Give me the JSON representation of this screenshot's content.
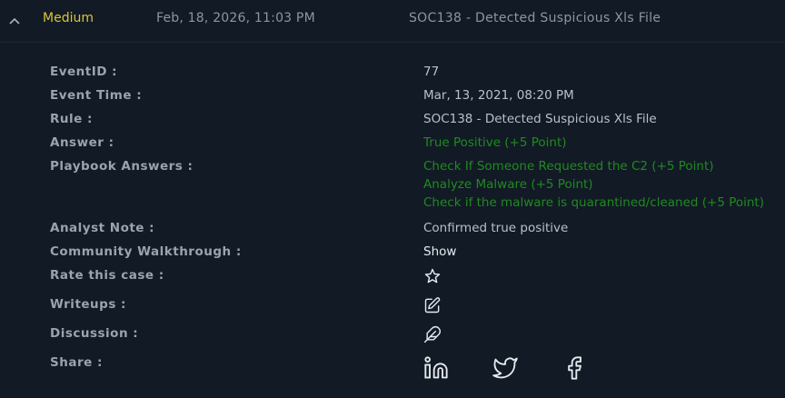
{
  "header": {
    "severity": "Medium",
    "date": "Feb, 18, 2026, 11:03 PM",
    "title": "SOC138 - Detected Suspicious Xls File"
  },
  "details": {
    "event_id_label": "EventID :",
    "event_id": "77",
    "event_time_label": "Event Time :",
    "event_time": "Mar, 13, 2021, 08:20 PM",
    "rule_label": "Rule :",
    "rule": "SOC138 - Detected Suspicious Xls File",
    "answer_label": "Answer :",
    "answer": "True Positive (+5 Point)",
    "playbook_label": "Playbook Answers :",
    "playbook_answers": [
      "Check If Someone Requested the C2 (+5 Point)",
      "Analyze Malware (+5 Point)",
      "Check if the malware is quarantined/cleaned (+5 Point)"
    ],
    "analyst_note_label": "Analyst Note :",
    "analyst_note": "Confirmed true positive",
    "walkthrough_label": "Community Walkthrough :",
    "walkthrough_link": "Show",
    "rate_label": "Rate this case :",
    "writeups_label": "Writeups :",
    "discussion_label": "Discussion :",
    "share_label": "Share :"
  },
  "icons": {
    "collapse": "chevron-up-icon",
    "rate": "star-icon",
    "writeups": "edit-icon",
    "discussion": "feather-icon",
    "share": [
      "linkedin-icon",
      "twitter-icon",
      "facebook-icon"
    ]
  },
  "colors": {
    "background": "#121a25",
    "severity_medium": "#d8c536",
    "answer_green": "#1f8a1f"
  }
}
